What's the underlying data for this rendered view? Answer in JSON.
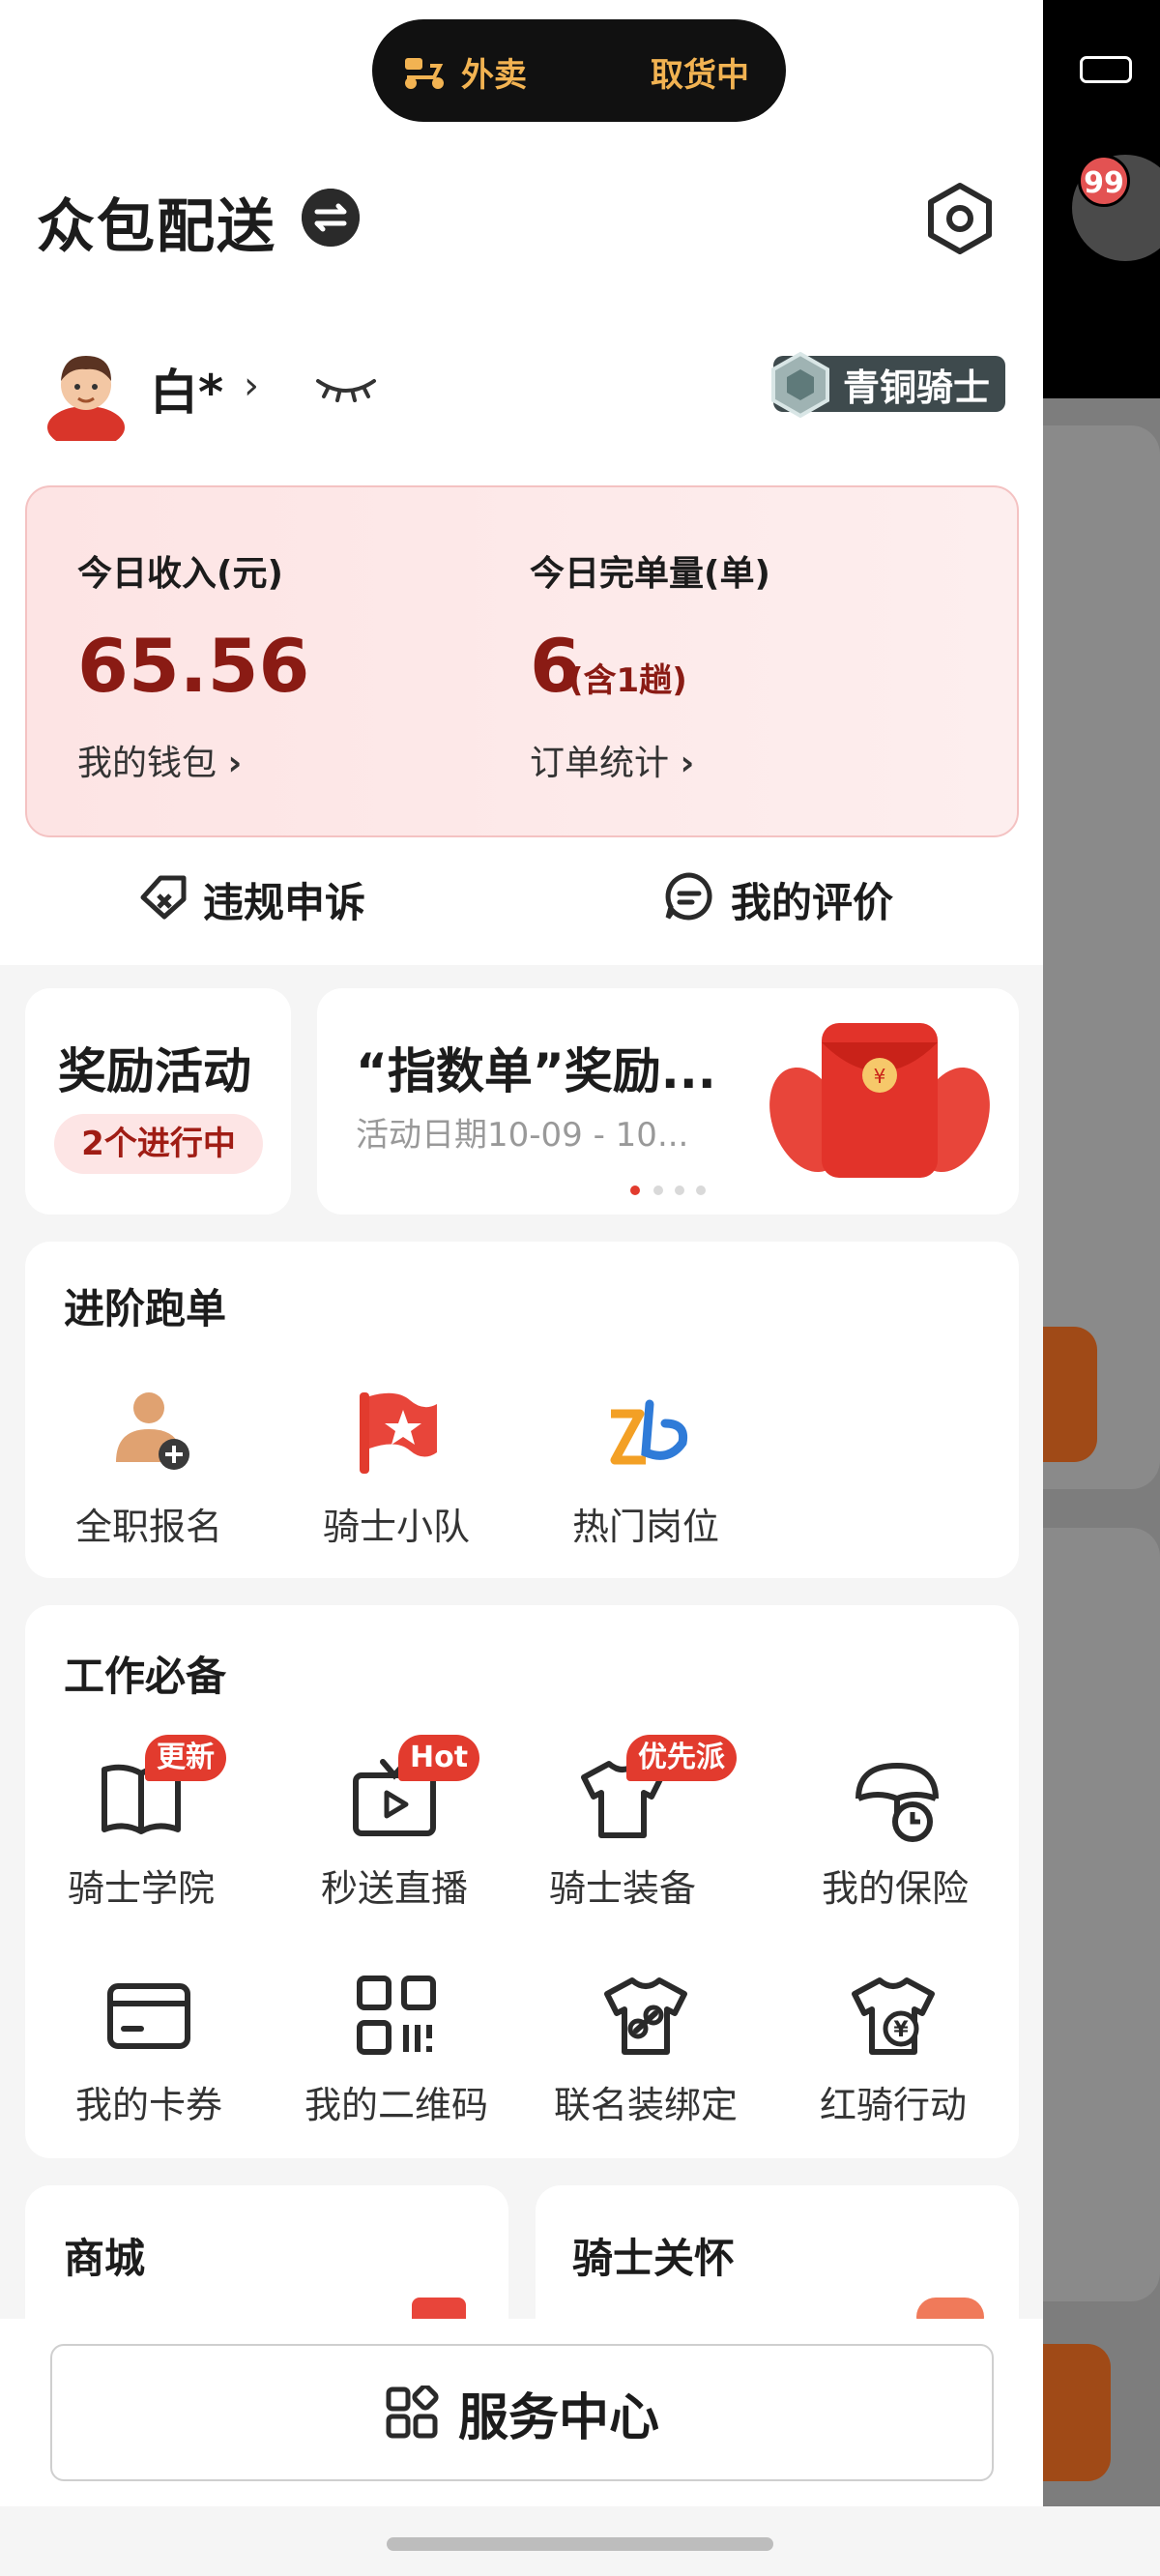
{
  "status_bar": {
    "order_type": "外卖",
    "order_status": "取货中",
    "bg_badge_count": "99"
  },
  "header": {
    "title": "众包配送"
  },
  "profile": {
    "name": "白*",
    "arrow": "›",
    "rank": "青铜骑士"
  },
  "stats": {
    "income_label": "今日收入(元)",
    "income_value": "65.56",
    "wallet_link": "我的钱包",
    "orders_label": "今日完单量(单)",
    "orders_value": "6",
    "orders_note": "(含1趟)",
    "orders_link": "订单统计"
  },
  "quick_links": [
    {
      "label": "违规申诉",
      "icon": "appeal-icon"
    },
    {
      "label": "我的评价",
      "icon": "comment-icon"
    }
  ],
  "rewards": {
    "title": "奖励活动",
    "status": "2个进行中"
  },
  "banner": {
    "title": "“指数单”奖励...",
    "date": "活动日期10-09 - 10..."
  },
  "advanced": {
    "title": "进阶跑单",
    "items": [
      {
        "label": "全职报名",
        "icon": "fulltime-signup-icon"
      },
      {
        "label": "骑士小队",
        "icon": "squad-flag-icon"
      },
      {
        "label": "热门岗位",
        "icon": "hot-jobs-icon"
      }
    ]
  },
  "work": {
    "title": "工作必备",
    "items": [
      {
        "label": "骑士学院",
        "icon": "book-icon",
        "tag": "更新"
      },
      {
        "label": "秒送直播",
        "icon": "live-tv-icon",
        "tag": "Hot"
      },
      {
        "label": "骑士装备",
        "icon": "tshirt-icon",
        "tag": "优先派"
      },
      {
        "label": "我的保险",
        "icon": "insurance-icon",
        "tag": ""
      },
      {
        "label": "我的卡券",
        "icon": "card-icon",
        "tag": ""
      },
      {
        "label": "我的二维码",
        "icon": "qrcode-icon",
        "tag": ""
      },
      {
        "label": "联名装绑定",
        "icon": "shirt-link-icon",
        "tag": ""
      },
      {
        "label": "红骑行动",
        "icon": "shirt-yen-icon",
        "tag": ""
      }
    ]
  },
  "bottom_cards": [
    {
      "title": "商城"
    },
    {
      "title": "骑士关怀"
    }
  ],
  "service": {
    "label": "服务中心"
  },
  "colors": {
    "accent": "#8a1b14",
    "tag": "#e23b2e",
    "pill_bg": "#fde5e5"
  }
}
